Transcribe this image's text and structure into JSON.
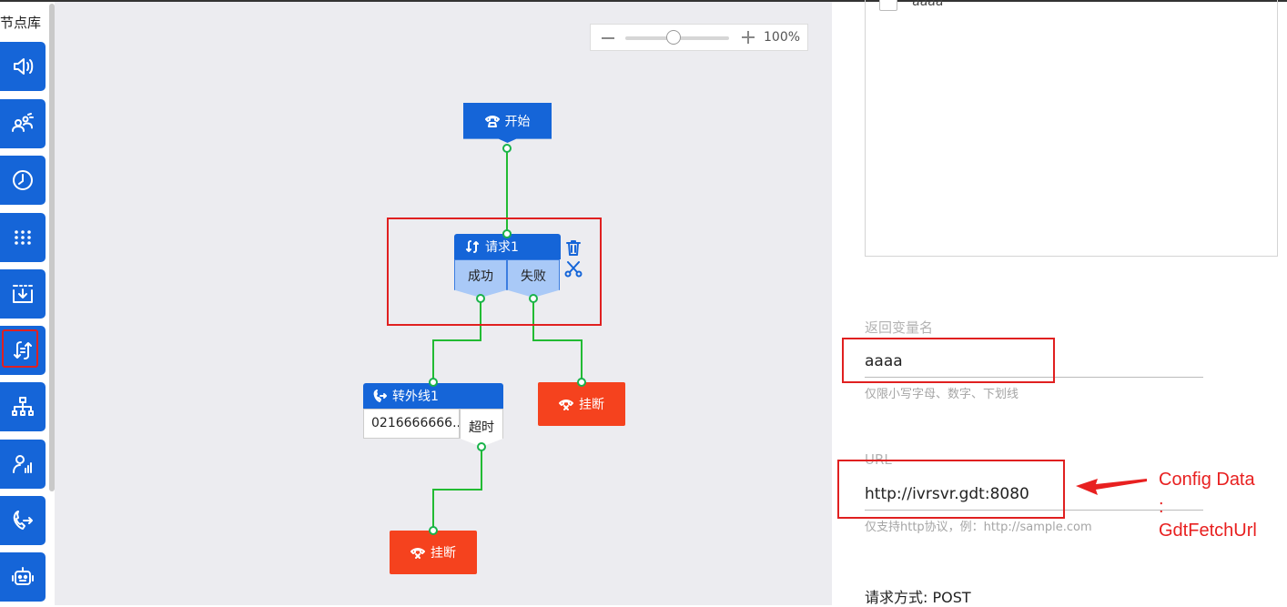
{
  "node_library": {
    "title": "节点库",
    "items": [
      {
        "icon": "speaker-icon"
      },
      {
        "icon": "group-icon"
      },
      {
        "icon": "clock-icon"
      },
      {
        "icon": "keypad-icon"
      },
      {
        "icon": "download-box-icon"
      },
      {
        "icon": "request-icon",
        "selected": true
      },
      {
        "icon": "org-chart-icon"
      },
      {
        "icon": "agent-stats-icon"
      },
      {
        "icon": "call-transfer-icon"
      },
      {
        "icon": "robot-icon"
      }
    ]
  },
  "zoom": {
    "level": "100%"
  },
  "flow": {
    "start": {
      "label": "开始"
    },
    "request": {
      "label": "请求1",
      "branches": [
        "成功",
        "失败"
      ]
    },
    "transfer": {
      "label": "转外线1",
      "number": "0216666666...",
      "timeout": "超时"
    },
    "hangup_right": {
      "label": "挂断"
    },
    "hangup_bottom": {
      "label": "挂断"
    }
  },
  "panel": {
    "checkbox_label": "aaaa",
    "return_var": {
      "label": "返回变量名",
      "value": "aaaa",
      "hint": "仅限小写字母、数字、下划线"
    },
    "url": {
      "label": "URL",
      "value": "http://ivrsvr.gdt:8080",
      "hint": "仅支持http协议，例：http://sample.com"
    },
    "method": "请求方式: POST"
  },
  "annotation": {
    "line1": "Config Data",
    "line2": ":",
    "line3": "GdtFetchUrl",
    "color": "#e82020"
  }
}
